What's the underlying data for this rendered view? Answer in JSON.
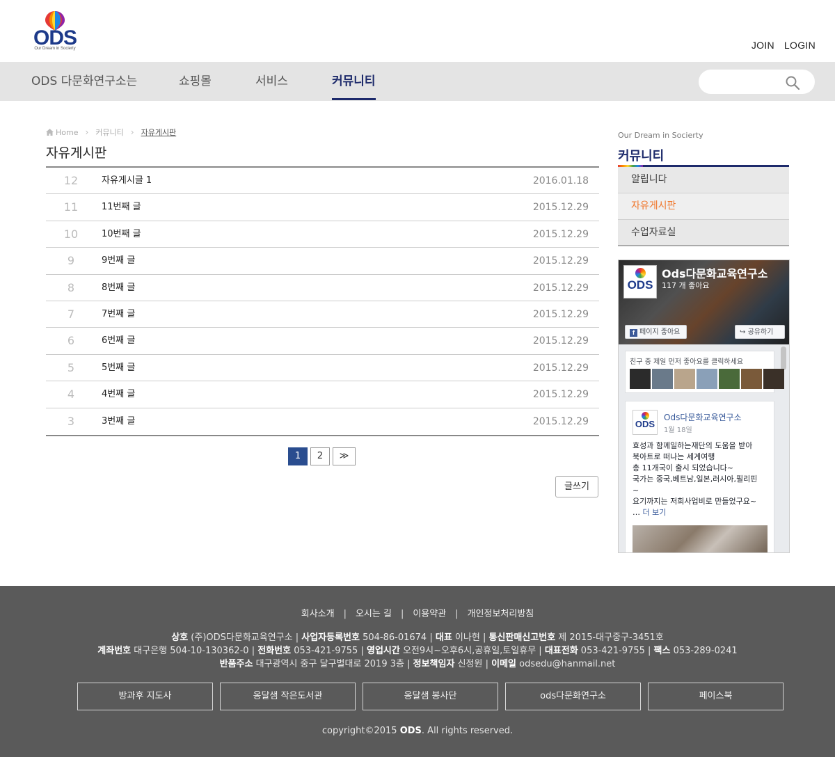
{
  "brand": {
    "logo_text": "ODS",
    "tagline": "Our Dream in Socierty"
  },
  "top_links": {
    "join": "JOIN",
    "login": "LOGIN"
  },
  "nav": {
    "items": [
      "ODS 다문화연구소는",
      "쇼핑몰",
      "서비스",
      "커뮤니티"
    ],
    "active_index": 3,
    "search_placeholder": ""
  },
  "breadcrumb": {
    "home": "Home",
    "parent": "커뮤니티",
    "current": "자유게시판"
  },
  "page_title": "자유게시판",
  "posts": [
    {
      "num": "12",
      "title": "자유게시글 1",
      "date": "2016.01.18"
    },
    {
      "num": "11",
      "title": "11번째 글",
      "date": "2015.12.29"
    },
    {
      "num": "10",
      "title": "10번째 글",
      "date": "2015.12.29"
    },
    {
      "num": "9",
      "title": "9번째 글",
      "date": "2015.12.29"
    },
    {
      "num": "8",
      "title": "8번째 글",
      "date": "2015.12.29"
    },
    {
      "num": "7",
      "title": "7번째 글",
      "date": "2015.12.29"
    },
    {
      "num": "6",
      "title": "6번째 글",
      "date": "2015.12.29"
    },
    {
      "num": "5",
      "title": "5번째 글",
      "date": "2015.12.29"
    },
    {
      "num": "4",
      "title": "4번째 글",
      "date": "2015.12.29"
    },
    {
      "num": "3",
      "title": "3번째 글",
      "date": "2015.12.29"
    }
  ],
  "pagination": {
    "pages": [
      "1",
      "2"
    ],
    "current": "1",
    "next": "≫"
  },
  "write_button": "글쓰기",
  "sidebar": {
    "subtitle": "Our Dream in Socierty",
    "title": "커뮤니티",
    "items": [
      "알립니다",
      "자유게시판",
      "수업자료실"
    ],
    "active_index": 1
  },
  "facebook": {
    "page_name": "Ods다문화교육연구소",
    "likes": "117 개 좋아요",
    "like_button": "페이지 좋아요",
    "share_button": "공유하기",
    "friends_text": "친구 중 제일 먼저 좋아요를 클릭하세요",
    "post": {
      "author": "Ods다문화교육연구소",
      "date": "1월 18일",
      "lines": [
        "효성과 함께일하는재단의 도움을 받아",
        "북아트로 떠나는 세계여행",
        "총 11개국이 출시 되었습니다~",
        "국가는 중국,베트남,일본,러시아,필리핀",
        "~",
        "요기까지는 저희사업비로 만들었구요~"
      ],
      "ellipsis": "…",
      "more": "더 보기"
    }
  },
  "footer": {
    "links": [
      "회사소개",
      "오시는 길",
      "이용약관",
      "개인정보처리방침"
    ],
    "info_line1": [
      {
        "label": "상호",
        "value": "(주)ODS다문화교육연구소"
      },
      {
        "label": "사업자등록번호",
        "value": "504-86-01674"
      },
      {
        "label": "대표",
        "value": "이나현"
      },
      {
        "label": "통신판매신고번호",
        "value": "제 2015-대구중구-3451호"
      }
    ],
    "info_line2": [
      {
        "label": "계좌번호",
        "value": "대구은행 504-10-130362-0"
      },
      {
        "label": "전화번호",
        "value": "053-421-9755"
      },
      {
        "label": "영업시간",
        "value": "오전9시~오후6시,공휴일,토일휴무"
      },
      {
        "label": "대표전화",
        "value": "053-421-9755"
      },
      {
        "label": "팩스",
        "value": "053-289-0241"
      }
    ],
    "info_line3": [
      {
        "label": "반품주소",
        "value": "대구광역시 중구 달구벌대로 2019 3층"
      },
      {
        "label": "정보책임자",
        "value": "신정원"
      },
      {
        "label": "이메일",
        "value": "odsedu@hanmail.net"
      }
    ],
    "buttons": [
      "방과후 지도사",
      "옹달샘 작은도서관",
      "옹달샘 봉사단",
      "ods다문화연구소",
      "페이스북"
    ],
    "copyright_prefix": "copyright©2015",
    "copyright_brand": "ODS",
    "copyright_suffix": ". All rights reserved."
  },
  "colors": {
    "nav_active": "#1d2a6b",
    "sidebar_active": "#f0762a",
    "page_active": "#2a4d8f",
    "footer_bg": "#5a5a5a"
  }
}
